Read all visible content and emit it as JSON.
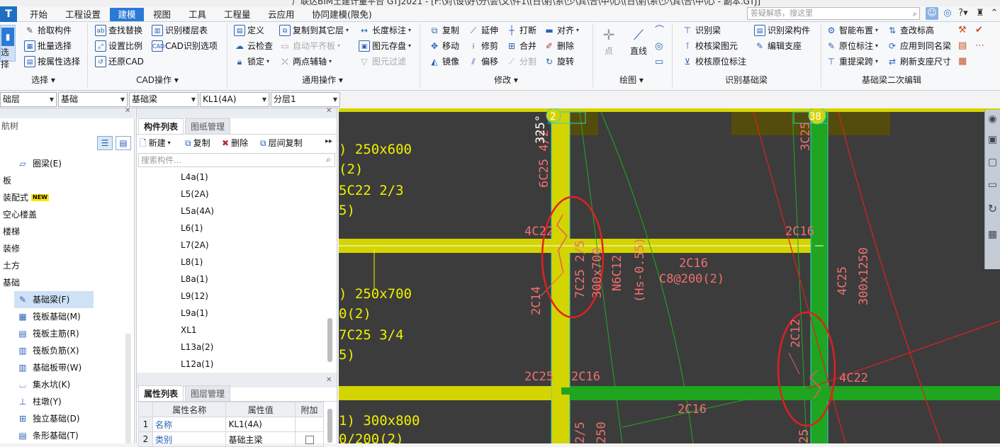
{
  "title_bar": {
    "text": "广联达BIM土建计量平台 GTJ2021 - [F:\\对\\设\\好\\分\\会\\文\\件1\\(日\\射\\系\\少\\宾\\合\\中\\心\\(日\\射\\系\\少\\宾\\合\\中\\心 - 副本.GTJ]"
  },
  "menu": {
    "logo": "T",
    "items": [
      "开始",
      "工程设置",
      "建模",
      "视图",
      "工具",
      "工程量",
      "云应用",
      "协同建模(限免)"
    ],
    "active": "建模",
    "search_placeholder": "答疑解惑，搜这里"
  },
  "ribbon": {
    "select_group": {
      "label": "选择",
      "big_button": "选择",
      "buttons": [
        "拾取构件",
        "批量选择",
        "按属性选择"
      ]
    },
    "cad_group": {
      "label": "CAD操作",
      "buttons": [
        "查找替换",
        "识别楼层表",
        "设置比例",
        "CAD识别选项",
        "还原CAD"
      ]
    },
    "common_group": {
      "label": "通用操作",
      "buttons": [
        "定义",
        "复制到其它层",
        "长度标注",
        "云检查",
        "自动平齐板",
        "图元存盘",
        "锁定",
        "两点辅轴",
        "图元过滤"
      ]
    },
    "modify_group": {
      "label": "修改",
      "buttons": [
        "复制",
        "延伸",
        "打断",
        "对齐",
        "移动",
        "修剪",
        "合并",
        "删除",
        "镜像",
        "偏移",
        "分割",
        "旋转"
      ]
    },
    "draw_group": {
      "label": "绘图",
      "buttons": [
        "点",
        "直线"
      ]
    },
    "recognize_group": {
      "label": "识别基础梁",
      "buttons": [
        "识别梁",
        "识别梁构件",
        "校核梁图元",
        "编辑支座",
        "校核原位标注"
      ]
    },
    "secondary_group": {
      "label": "基础梁二次编辑",
      "buttons": [
        "智能布置",
        "查改标高",
        "原位标注",
        "应用到同名梁",
        "重提梁跨",
        "刷新支座尺寸"
      ]
    }
  },
  "combos": [
    "础层",
    "基础",
    "基础梁",
    "KL1(4A)",
    "分层1"
  ],
  "nav_tree": {
    "title": "航树",
    "items": [
      {
        "label": "圈梁(E)",
        "icon": "ring-beam-icon",
        "indent": true
      },
      {
        "label": "板",
        "indent": false
      },
      {
        "label": "装配式",
        "indent": false,
        "badge": "NEW"
      },
      {
        "label": "空心楼盖",
        "indent": false
      },
      {
        "label": "楼梯",
        "indent": false
      },
      {
        "label": "装修",
        "indent": false
      },
      {
        "label": "土方",
        "indent": false
      },
      {
        "label": "基础",
        "indent": false
      },
      {
        "label": "基础梁(F)",
        "icon": "foundation-beam-icon",
        "indent": true,
        "selected": true
      },
      {
        "label": "筏板基础(M)",
        "icon": "raft-foundation-icon",
        "indent": true
      },
      {
        "label": "筏板主筋(R)",
        "icon": "raft-main-rebar-icon",
        "indent": true
      },
      {
        "label": "筏板负筋(X)",
        "icon": "raft-negative-rebar-icon",
        "indent": true
      },
      {
        "label": "基础板带(W)",
        "icon": "foundation-strip-icon",
        "indent": true
      },
      {
        "label": "集水坑(K)",
        "icon": "sump-pit-icon",
        "indent": true
      },
      {
        "label": "柱墩(Y)",
        "icon": "column-pier-icon",
        "indent": true
      },
      {
        "label": "独立基础(D)",
        "icon": "isolated-footing-icon",
        "indent": true
      },
      {
        "label": "条形基础(T)",
        "icon": "strip-footing-icon",
        "indent": true
      }
    ]
  },
  "component_panel": {
    "tabs": [
      "构件列表",
      "图纸管理"
    ],
    "toolbar": [
      "新建",
      "复制",
      "删除",
      "层间复制"
    ],
    "search_placeholder": "搜索构件...",
    "items": [
      "L4a(1)",
      "L5(2A)",
      "L5a(4A)",
      "L6(1)",
      "L7(2A)",
      "L8(1)",
      "L8a(1)",
      "L9(12)",
      "L9a(1)",
      "XL1",
      "L13a(2)",
      "L12a(1)"
    ]
  },
  "property_panel": {
    "tabs": [
      "属性列表",
      "图层管理"
    ],
    "headers": [
      "属性名称",
      "属性值",
      "附加"
    ],
    "rows": [
      {
        "no": "1",
        "name": "名称",
        "value": "KL1(4A)",
        "extra": ""
      },
      {
        "no": "2",
        "name": "类别",
        "value": "基础主梁",
        "extra": "checkbox"
      }
    ]
  },
  "canvas": {
    "axis_labels": [
      "2",
      "38"
    ],
    "yellow_texts": [
      ") 250x600",
      "(2)",
      "5C22 2/3",
      "5)",
      ") 250x700",
      "0(2)",
      "7C25 3/4",
      "5)",
      "1) 300x800",
      "0/200(2)"
    ],
    "red_texts": [
      "3C25",
      "6C25 4/2",
      "325°",
      "4C22",
      "2C16",
      "7C25 2/5",
      "300x700",
      "N6C12",
      "(Hs-0.55)",
      "2C16",
      "C8@200(2)",
      "4C25",
      "300x1250",
      "2C14",
      "2C12",
      "4C22",
      "2C25",
      "2C16",
      "2C16",
      "2/5",
      "250",
      "25"
    ]
  },
  "colors": {
    "accent": "#2a7ad5",
    "canvas_bg": "#3c3c3c",
    "beam_yellow": "#d4d400",
    "beam_green": "#1fa51f",
    "cad_red": "#ff6a6a",
    "cad_yellow": "#f0f000"
  }
}
